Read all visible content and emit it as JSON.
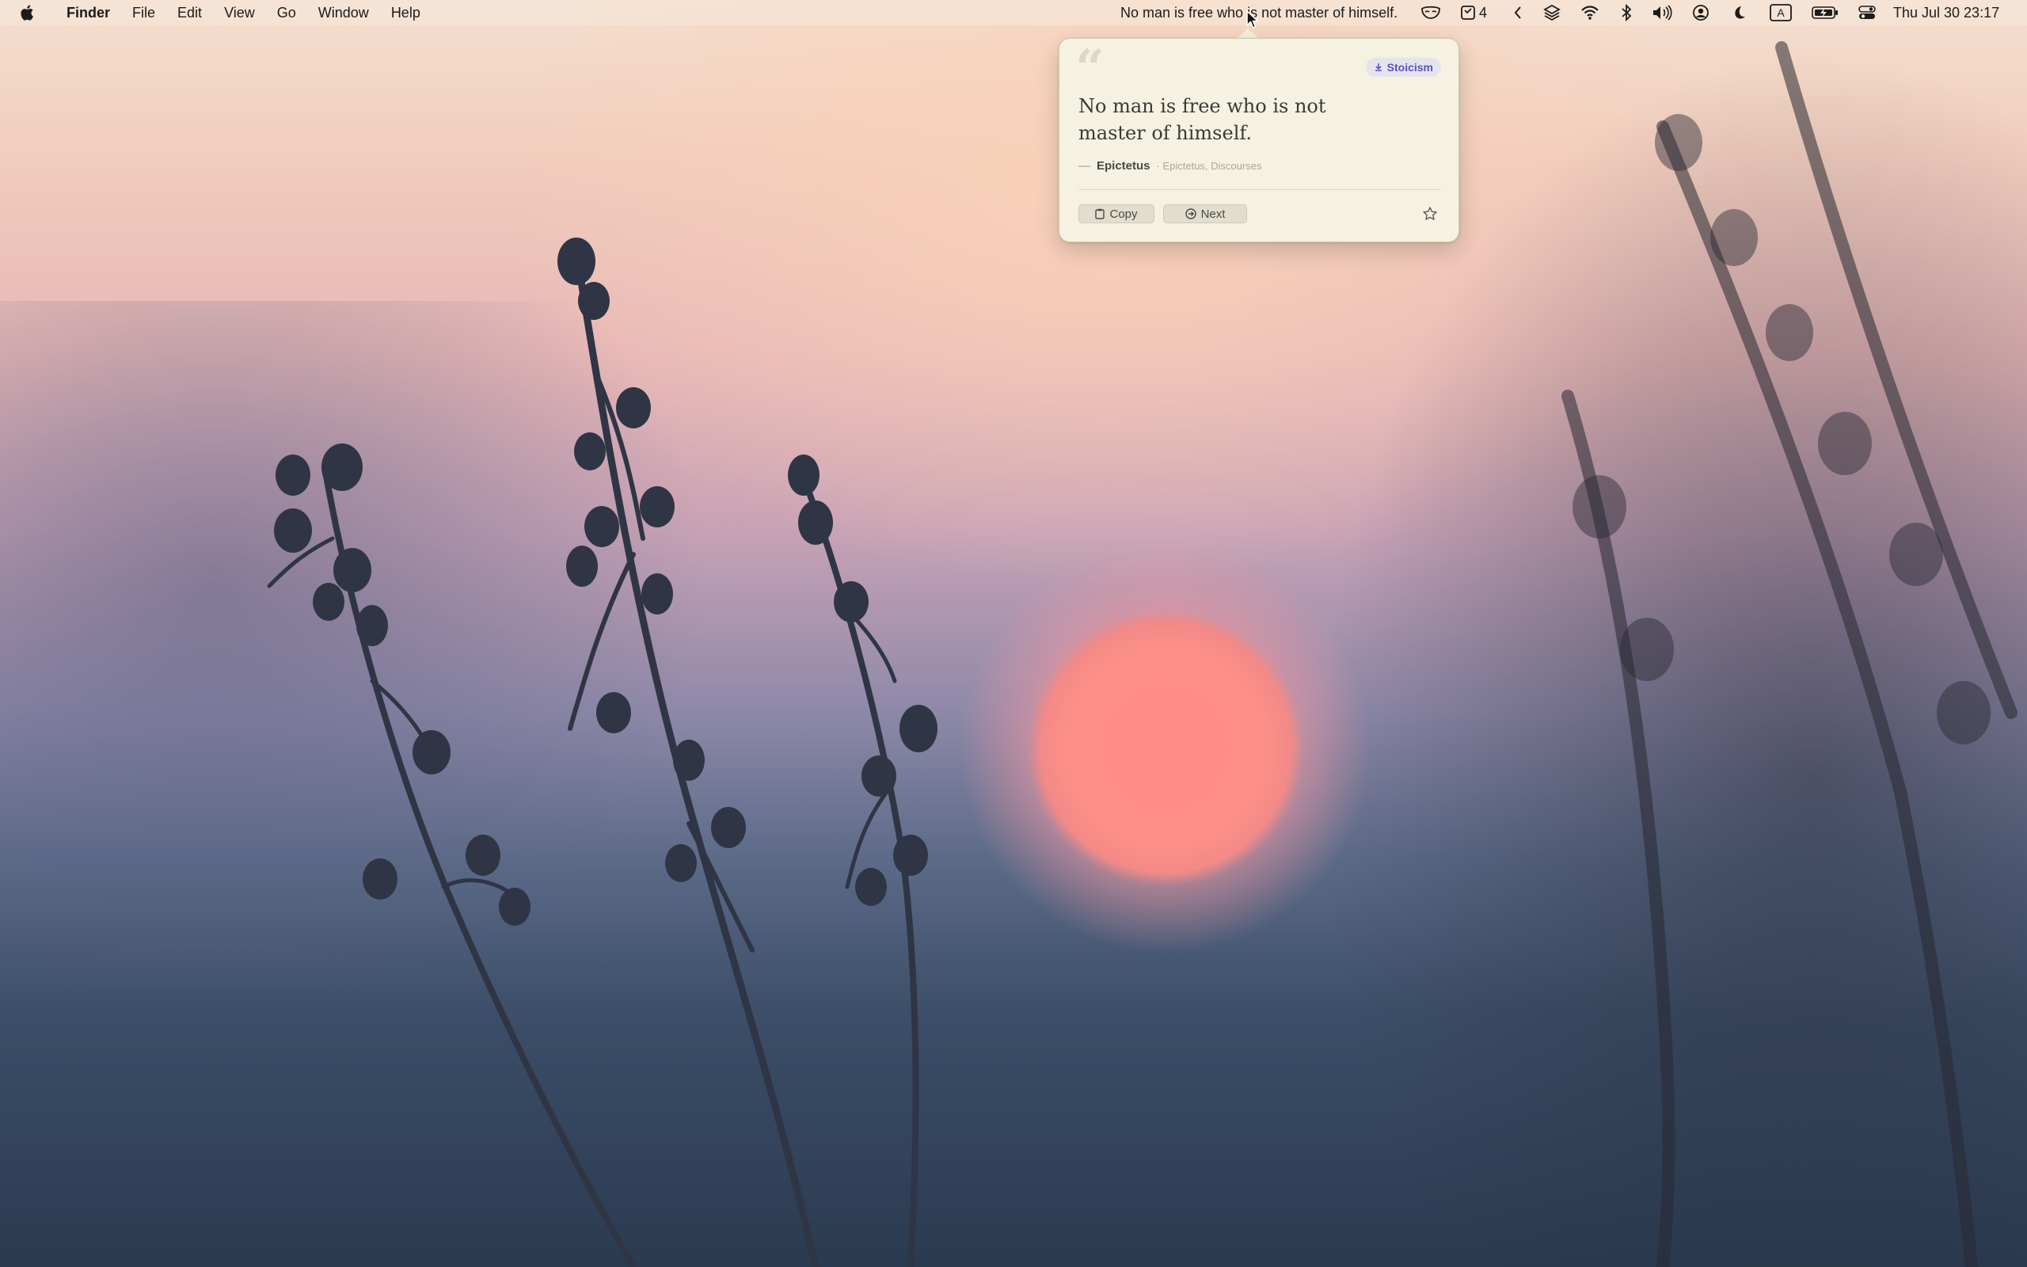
{
  "menubar": {
    "app_name": "Finder",
    "menus": [
      "File",
      "Edit",
      "View",
      "Go",
      "Window",
      "Help"
    ],
    "status_quote": "No man is free who is not master of himself.",
    "reminders_count": "4",
    "clock": "Thu Jul 30  23:17",
    "icons": [
      "apple-icon",
      "mask-icon",
      "reminders-icon",
      "chevron-left-icon",
      "layers-icon",
      "wifi-icon",
      "bluetooth-icon",
      "volume-icon",
      "user-icon",
      "moon-icon",
      "input-source-icon",
      "battery-icon",
      "control-center-icon"
    ],
    "input_source_label": "A"
  },
  "popover": {
    "tag": "Stoicism",
    "quote": "No man is free who is not master of himself.",
    "dash": "—",
    "author": "Epictetus",
    "source": "· Epictetus, Discourses",
    "copy_label": "Copy",
    "next_label": "Next",
    "accent_color": "#5a55b8",
    "background_color": "#f6f2e1"
  }
}
